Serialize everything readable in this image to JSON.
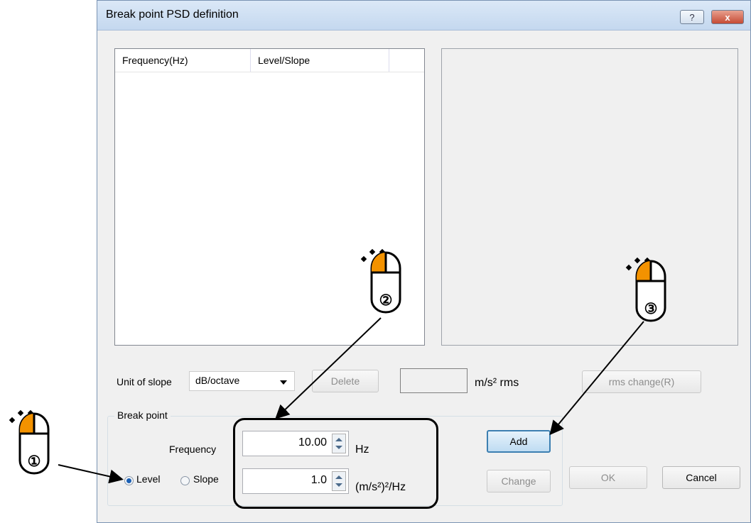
{
  "window": {
    "title": "Break point PSD definition",
    "help_label": "?",
    "close_label": "x"
  },
  "list": {
    "columns": [
      "Frequency(Hz)",
      "Level/Slope"
    ]
  },
  "slope": {
    "label": "Unit of slope",
    "selected": "dB/octave"
  },
  "buttons": {
    "delete": "Delete",
    "rms_change": "rms change(R)",
    "add": "Add",
    "change": "Change",
    "ok": "OK",
    "cancel": "Cancel"
  },
  "rms": {
    "value": "",
    "unit": "m/s² rms"
  },
  "break_point": {
    "group_title": "Break point",
    "frequency_label": "Frequency",
    "frequency_value": "10.00",
    "frequency_unit": "Hz",
    "level_value": "1.0",
    "level_unit": "(m/s²)²/Hz",
    "mode_options": [
      "Level",
      "Slope"
    ],
    "mode_selected": "Level"
  },
  "annotations": {
    "steps": [
      "①",
      "②",
      "③"
    ]
  },
  "colors": {
    "mouse_accent": "#f39200",
    "title_bar": "#c4d8ef",
    "close_button": "#c64b34"
  }
}
